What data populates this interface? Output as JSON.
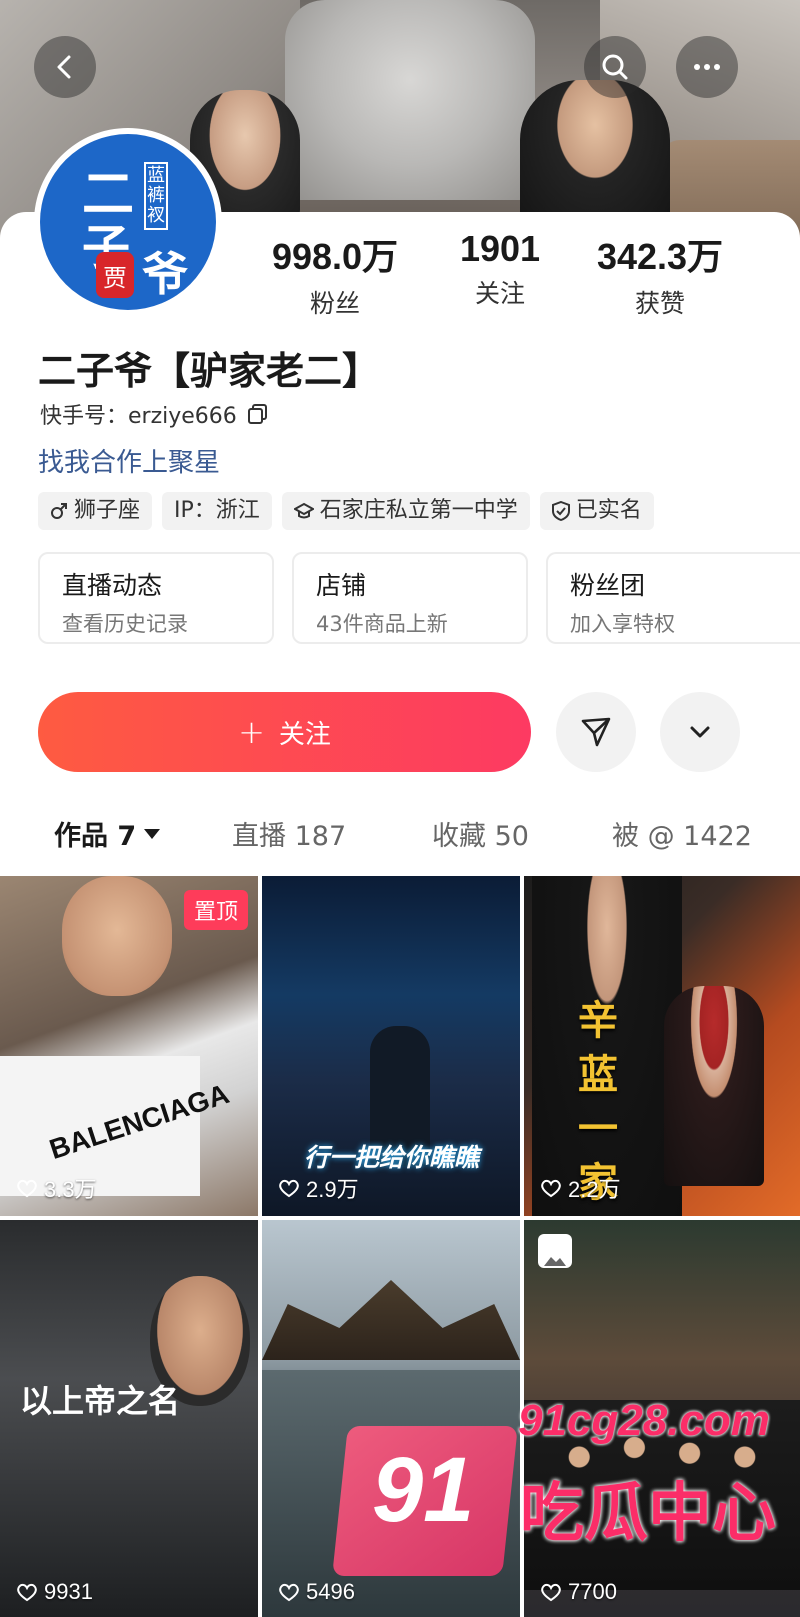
{
  "header": {
    "back_icon": "chevron-left-icon",
    "search_icon": "search-icon",
    "more_icon": "more-horizontal-icon"
  },
  "profile": {
    "avatar_text": {
      "main1": "二",
      "main2": "子",
      "main3": "爷",
      "sub": "蓝裤衩",
      "seal": "贾"
    },
    "stats": [
      {
        "value": "998.0万",
        "label": "粉丝"
      },
      {
        "value": "1901",
        "label": "关注"
      },
      {
        "value": "342.3万",
        "label": "获赞"
      }
    ],
    "name": "二子爷【驴家老二】",
    "kuaishou_id": "快手号：erziye666",
    "cooperation_link": "找我合作上聚星",
    "tags": [
      {
        "icon": "male-icon",
        "label": "狮子座"
      },
      {
        "icon": "",
        "label": "IP：浙江"
      },
      {
        "icon": "school-icon",
        "label": "石家庄私立第一中学"
      },
      {
        "icon": "shield-check-icon",
        "label": "已实名"
      }
    ],
    "features": [
      {
        "title": "直播动态",
        "subtitle": "查看历史记录"
      },
      {
        "title": "店铺",
        "subtitle": "43件商品上新"
      },
      {
        "title": "粉丝团",
        "subtitle": "加入享特权"
      }
    ]
  },
  "actions": {
    "follow_plus": "+",
    "follow_label": "关注",
    "message_icon": "send-icon",
    "dropdown_icon": "chevron-down-icon"
  },
  "tabs": [
    {
      "label": "作品 7",
      "active": true
    },
    {
      "label": "直播 187",
      "active": false
    },
    {
      "label": "收藏 50",
      "active": false
    },
    {
      "label": "被 @ 1422",
      "active": false
    }
  ],
  "videos": [
    {
      "likes": "3.3万",
      "badge": "置顶",
      "overlay": "BALENCIAGA"
    },
    {
      "likes": "2.9万",
      "overlay": "行一把给你瞧瞧"
    },
    {
      "likes": "2.2万",
      "overlay": "辛蓝一家"
    },
    {
      "likes": "9931",
      "overlay": "以上帝之名"
    },
    {
      "likes": "5496",
      "overlay": ""
    },
    {
      "likes": "7700",
      "overlay": ""
    }
  ],
  "watermark": {
    "number": "91",
    "url": "91cg28.com",
    "name": "吃瓜中心"
  },
  "colors": {
    "follow_gradient_start": "#fe5b41",
    "follow_gradient_end": "#fd3a62",
    "link": "#3a5a92",
    "pin_badge": "#fe3c5a",
    "watermark": "#fb2d68"
  }
}
